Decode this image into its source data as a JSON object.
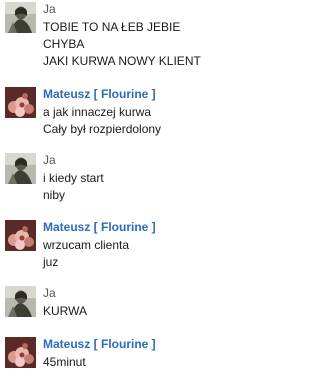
{
  "messages": [
    {
      "sender": "Ja",
      "avatar": "person-avatar-icon",
      "lines": [
        "TOBIE TO NA ŁEB JEBIE",
        "CHYBA",
        "JAKI KURWA NOWY KLIENT"
      ]
    },
    {
      "sender": "Mateusz [ Flourine ]",
      "avatar": "flower-avatar-icon",
      "lines": [
        "a jak innaczej kurwa",
        "Cały był rozpierdolony"
      ]
    },
    {
      "sender": "Ja",
      "avatar": "person-avatar-icon",
      "lines": [
        "i kiedy start",
        "niby"
      ]
    },
    {
      "sender": "Mateusz [ Flourine ]",
      "avatar": "flower-avatar-icon",
      "lines": [
        "wrzucam clienta",
        "juz"
      ]
    },
    {
      "sender": "Ja",
      "avatar": "person-avatar-icon",
      "lines": [
        "KURWA"
      ]
    },
    {
      "sender": "Mateusz [ Flourine ]",
      "avatar": "flower-avatar-icon",
      "lines": [
        "45minut"
      ]
    }
  ],
  "colors": {
    "self_name": "#555555",
    "other_name": "#2a6cb7",
    "message_text": "#1a1a1a",
    "background": "#ffffff"
  }
}
